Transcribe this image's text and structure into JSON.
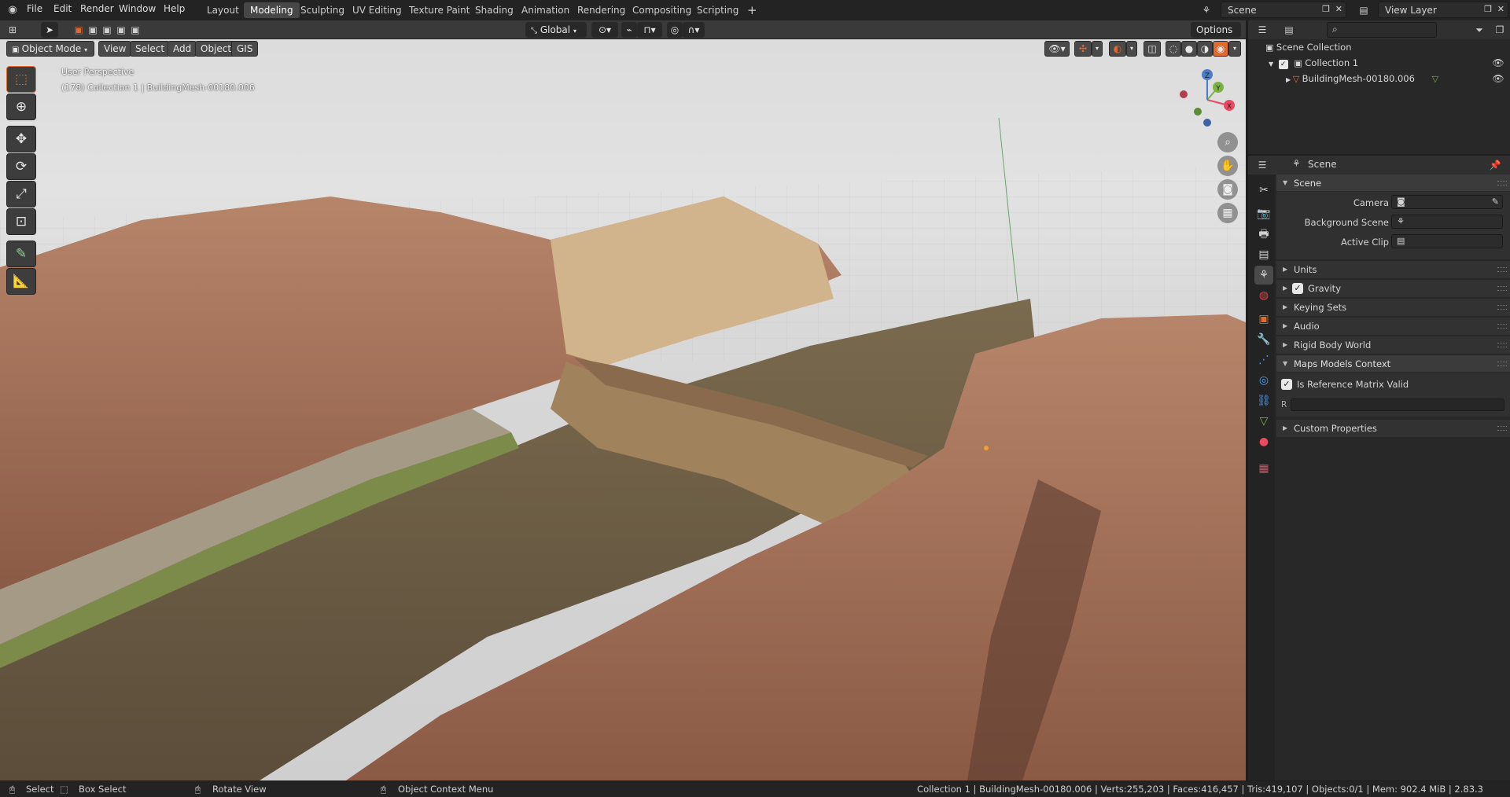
{
  "menus": [
    "File",
    "Edit",
    "Render",
    "Window",
    "Help"
  ],
  "workspaces": [
    {
      "label": "Layout",
      "active": false
    },
    {
      "label": "Modeling",
      "active": true
    },
    {
      "label": "Sculpting",
      "active": false
    },
    {
      "label": "UV Editing",
      "active": false
    },
    {
      "label": "Texture Paint",
      "active": false
    },
    {
      "label": "Shading",
      "active": false
    },
    {
      "label": "Animation",
      "active": false
    },
    {
      "label": "Rendering",
      "active": false
    },
    {
      "label": "Compositing",
      "active": false
    },
    {
      "label": "Scripting",
      "active": false
    }
  ],
  "add_workspace": "+",
  "scene_field": "Scene",
  "view_layer_field": "View Layer",
  "tool_header": {
    "orientation": "Global",
    "options": "Options"
  },
  "viewport_header": {
    "mode": "Object Mode",
    "view": "View",
    "select": "Select",
    "add": "Add",
    "object": "Object",
    "gis": "GIS"
  },
  "viewport_overlay": {
    "perspective": "User Perspective",
    "context": "(178) Collection 1 | BuildingMesh-00180.006"
  },
  "gizmo_axes": {
    "x": "X",
    "y": "Y",
    "z": "Z"
  },
  "outliner": {
    "scene_collection": "Scene Collection",
    "collection": "Collection 1",
    "object": "BuildingMesh-00180.006"
  },
  "properties": {
    "header_title": "Scene",
    "panel_scene": "Scene",
    "camera_label": "Camera",
    "background_scene_label": "Background Scene",
    "active_clip_label": "Active Clip",
    "units": "Units",
    "gravity": "Gravity",
    "keying_sets": "Keying Sets",
    "audio": "Audio",
    "rigid_body_world": "Rigid Body World",
    "maps_models_context": "Maps Models Context",
    "is_reference_matrix_valid": "Is Reference Matrix Valid",
    "r_label": "R",
    "custom_properties": "Custom Properties"
  },
  "status": {
    "select": "Select",
    "box_select": "Box Select",
    "rotate_view": "Rotate View",
    "context_menu": "Object Context Menu",
    "info": "Collection 1 | BuildingMesh-00180.006 | Verts:255,203 | Faces:416,457 | Tris:419,107 | Objects:0/1 | Mem: 902.4 MiB | 2.83.3"
  },
  "colors": {
    "accent": "#5a81b3",
    "active_orange": "#e06b2c",
    "axis_x": "#e84a5f",
    "axis_y": "#7cb342",
    "axis_z": "#4a7cc9"
  }
}
